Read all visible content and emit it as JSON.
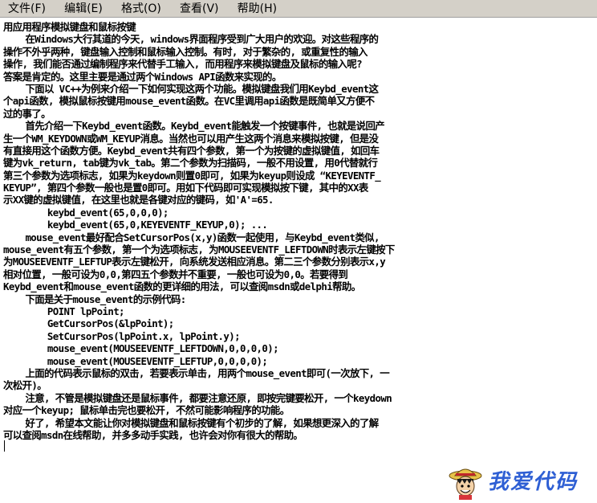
{
  "menu": {
    "file": "文件(F)",
    "edit": "编辑(E)",
    "format": "格式(O)",
    "view": "查看(V)",
    "help": "帮助(H)"
  },
  "document": {
    "lines": [
      "用应用程序模拟键盘和鼠标按键",
      "    在Windows大行其道的今天, windows界面程序受到广大用户的欢迎。对这些程序的",
      "操作不外乎两种, 键盘输入控制和鼠标输入控制。有时, 对于繁杂的, 或重复性的输入",
      "操作, 我们能否通过编制程序来代替手工输入, 而用程序来模拟键盘及鼠标的输入呢?",
      "答案是肯定的。这里主要是通过两个Windows API函数来实现的。",
      "    下面以 VC++为例来介绍一下如何实现这两个功能。模拟键盘我们用Keybd_event这",
      "个api函数, 模拟鼠标按键用mouse_event函数。在VC里调用api函数是既简单又方便不",
      "过的事了。",
      "    首先介绍一下Keybd_event函数。Keybd_event能触发一个按键事件, 也就是说回产",
      "生一个WM_KEYDOWN或WM_KEYUP消息。当然也可以用产生这两个消息来模拟按键, 但是没",
      "有直接用这个函数方便。Keybd_event共有四个参数, 第一个为按键的虚拟键值, 如回车",
      "键为vk_return, tab键为vk_tab。第二个参数为扫描码, 一般不用设置, 用0代替就行",
      "第三个参数为选项标志, 如果为keydown则置0即可, 如果为keyup则设成 “KEYEVENTF_",
      "KEYUP”, 第四个参数一般也是置0即可。用如下代码即可实现模拟按下键, 其中的XX表",
      "示XX键的虚拟键值, 在这里也就是各键对应的键码, 如'A'=65.",
      "        keybd_event(65,0,0,0);",
      "        keybd_event(65,0,KEYEVENTF_KEYUP,0); ...",
      "    mouse_event最好配合SetCursorPos(x,y)函数一起使用, 与Keybd_event类似,",
      "mouse_event有五个参数, 第一个为选项标志, 为MOUSEEVENTF_LEFTDOWN时表示左键按下",
      "为MOUSEEVENTF_LEFTUP表示左键松开, 向系统发送相应消息。第二三个参数分别表示x,y",
      "相对位置, 一般可设为0,0,第四五个参数并不重要, 一般也可设为0,0。若要得到",
      "Keybd_event和mouse_event函数的更详细的用法, 可以查阅msdn或delphi帮助。",
      "    下面是关于mouse_event的示例代码:",
      "        POINT lpPoint;",
      "        GetCursorPos(&lpPoint);",
      "        SetCursorPos(lpPoint.x, lpPoint.y);",
      "        mouse_event(MOUSEEVENTF_LEFTDOWN,0,0,0,0);",
      "        mouse_event(MOUSEEVENTF_LEFTUP,0,0,0,0);",
      "    上面的代码表示鼠标的双击, 若要表示单击, 用两个mouse_event即可(一次放下, 一",
      "次松开)。",
      "    注意, 不管是模拟键盘还是鼠标事件, 都要注意还原, 即按完键要松开, 一个keydown",
      "对应一个keyup; 鼠标单击完也要松开, 不然可能影响程序的功能。",
      "    好了, 希望本文能让你对模拟键盘和鼠标按键有个初步的了解, 如果想更深入的了解",
      "可以查阅msdn在线帮助, 并多多动手实践, 也许会对你有很大的帮助。"
    ]
  },
  "watermark": {
    "text": "我爱代码",
    "mascot_icon": "straw-hat-pirate-icon",
    "text_color": "#2e5fd4"
  }
}
